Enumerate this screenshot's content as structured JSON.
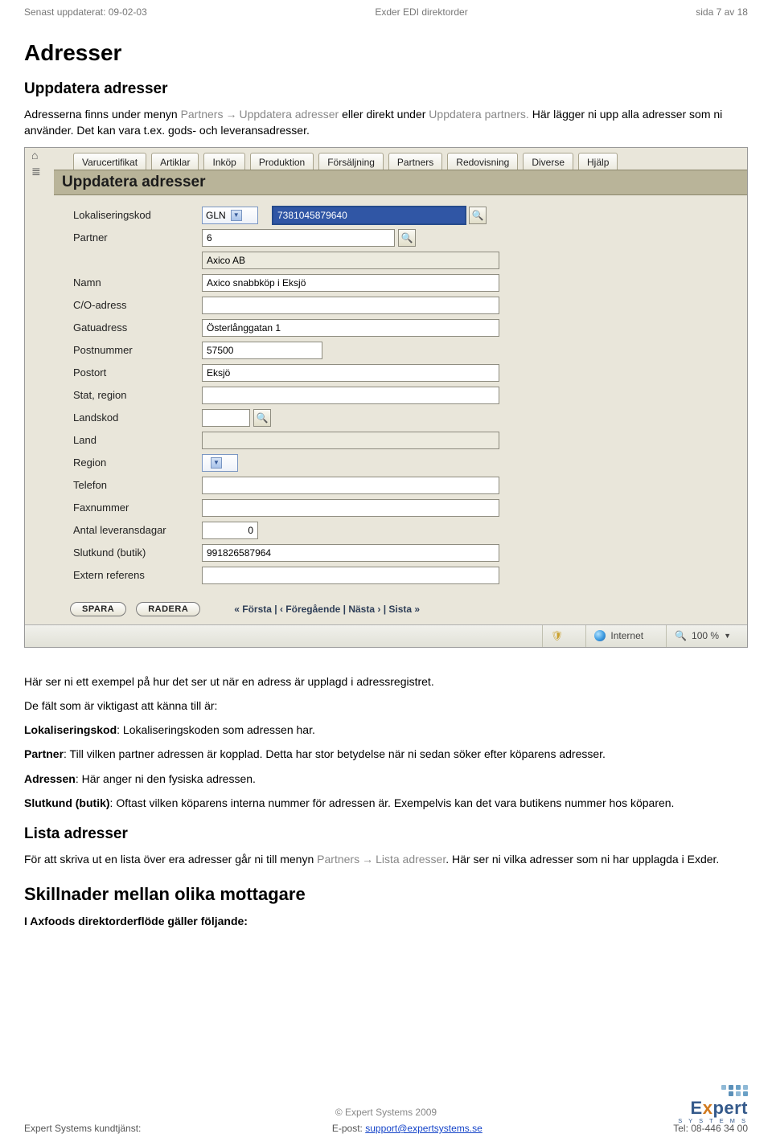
{
  "header": {
    "left": "Senast uppdaterat: 09-02-03",
    "center": "Exder EDI direktorder",
    "right": "sida 7 av 18"
  },
  "title": "Adresser",
  "intro_heading": "Uppdatera adresser",
  "intro_p1_a": "Adresserna finns under menyn ",
  "intro_menu1": "Partners",
  "intro_menu2": "Uppdatera adresser",
  "intro_p1_b": " eller direkt under ",
  "intro_menu3": "Uppdatera partners.",
  "intro_p1_c": " Här lägger ni upp alla adresser som ni använder. Det kan vara t.ex. gods- och leveransadresser.",
  "tabs": [
    "Varucertifikat",
    "Artiklar",
    "Inköp",
    "Produktion",
    "Försäljning",
    "Partners",
    "Redovisning",
    "Diverse",
    "Hjälp"
  ],
  "section_title": "Uppdatera adresser",
  "form": {
    "labels": {
      "lokaliseringskod": "Lokaliseringskod",
      "partner": "Partner",
      "namn": "Namn",
      "co": "C/O-adress",
      "gatu": "Gatuadress",
      "postnr": "Postnummer",
      "postort": "Postort",
      "stat": "Stat, region",
      "landskod": "Landskod",
      "land": "Land",
      "region": "Region",
      "telefon": "Telefon",
      "fax": "Faxnummer",
      "levdagar": "Antal leveransdagar",
      "slutkund": "Slutkund (butik)",
      "extref": "Extern referens"
    },
    "select_lok": "GLN",
    "val_lok": "7381045879640",
    "val_partner": "6",
    "val_partner_name": "Axico AB",
    "val_namn": "Axico snabbköp i Eksjö",
    "val_co": "",
    "val_gatu": "Österlånggatan 1",
    "val_postnr": "57500",
    "val_postort": "Eksjö",
    "val_stat": "",
    "val_landskod": "",
    "val_land": "",
    "val_region": "",
    "val_telefon": "",
    "val_fax": "",
    "val_levdagar": "0",
    "val_slutkund": "991826587964",
    "val_extref": ""
  },
  "buttons": {
    "spara": "SPARA",
    "radera": "RADERA",
    "pager": "«  Första  |  ‹  Föregående  |  Nästa  ›  |  Sista  »"
  },
  "ie": {
    "internet": "Internet",
    "zoom": "100 %"
  },
  "doc": {
    "p_ex": "Här ser ni ett exempel på hur det ser ut när en adress är upplagd i adressregistret.",
    "p_fields": "De fält som är viktigast att känna till är:",
    "p_lok_l": "Lokaliseringskod",
    "p_lok_t": ": Lokaliseringskoden som adressen har.",
    "p_par_l": "Partner",
    "p_par_t": ": Till vilken partner adressen är kopplad. Detta har stor betydelse när ni sedan söker efter köparens adresser.",
    "p_adr_l": "Adressen",
    "p_adr_t": ": Här anger ni den fysiska adressen.",
    "p_slu_l": "Slutkund (butik)",
    "p_slu_t": ": Oftast vilken köparens interna nummer för adressen är. Exempelvis kan det vara butikens nummer hos köparen.",
    "h_lista": "Lista adresser",
    "p_lista_a": "För att skriva ut en lista över era adresser går ni till menyn ",
    "p_lista_m1": "Partners",
    "p_lista_m2": "Lista adresser",
    "p_lista_b": ". Här ser ni vilka adresser som ni har upplagda i Exder.",
    "h_skil": "Skillnader mellan olika mottagare",
    "p_skil": "I Axfoods direktorderflöde gäller följande:"
  },
  "footer": {
    "copy": "© Expert Systems 2009",
    "left": "Expert Systems kundtjänst:",
    "mid_label": "E-post: ",
    "mid_link": "support@expertsystems.se",
    "right": "Tel: 08-446 34 00"
  }
}
